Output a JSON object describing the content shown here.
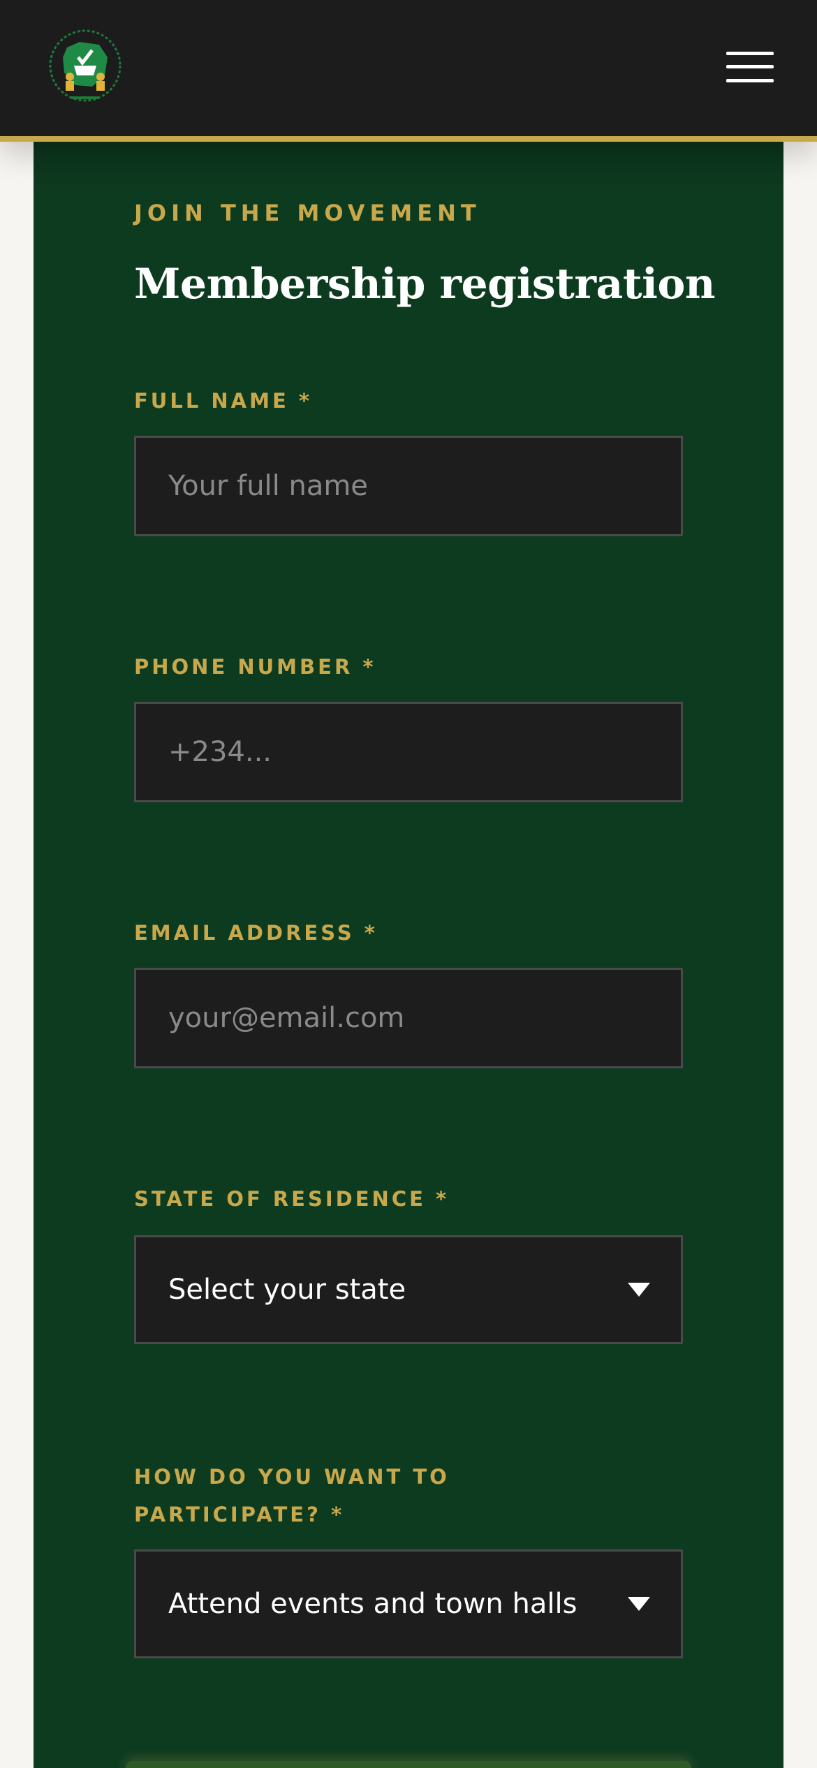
{
  "form": {
    "eyebrow": "JOIN THE MOVEMENT",
    "title": "Membership registration",
    "fields": {
      "full_name": {
        "label": "FULL NAME *",
        "placeholder": "Your full name"
      },
      "phone": {
        "label": "PHONE NUMBER *",
        "placeholder": "+234..."
      },
      "email": {
        "label": "EMAIL ADDRESS *",
        "placeholder": "your@email.com"
      },
      "state": {
        "label": "STATE OF RESIDENCE *",
        "selected": "Select your state"
      },
      "participation": {
        "label": "HOW DO YOU WANT TO PARTICIPATE? *",
        "selected": "Attend events and town halls"
      }
    }
  },
  "colors": {
    "header_bg": "#1c1c1c",
    "accent_gold": "#c9a84c",
    "card_green": "#0d3b20",
    "input_bg": "#1d1d1d"
  },
  "icons": {
    "logo": "inp-logo",
    "menu": "hamburger-menu-icon",
    "dropdown": "caret-down-icon"
  }
}
